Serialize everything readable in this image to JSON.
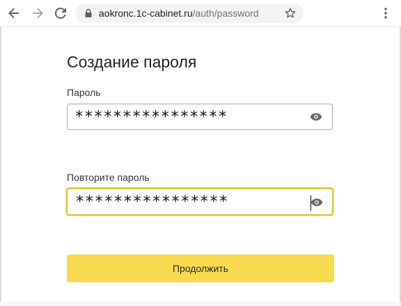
{
  "browser": {
    "url_host": "aokronc.1c-cabinet.ru",
    "url_path": "/auth/password",
    "back_icon": "arrow-left-icon",
    "forward_icon": "arrow-right-icon",
    "reload_icon": "reload-icon",
    "lock_icon": "lock-icon",
    "bookmark_icon": "star-icon",
    "menu_icon": "kebab-menu-icon"
  },
  "form": {
    "title": "Создание пароля",
    "password_label": "Пароль",
    "password_value": "****************",
    "repeat_label": "Повторите пароль",
    "repeat_value": "****************",
    "show_password_icon": "eye-icon",
    "submit_label": "Продолжить"
  },
  "colors": {
    "accent": "#f8da4e",
    "focus_border": "#e2c33a",
    "text": "#222222"
  }
}
